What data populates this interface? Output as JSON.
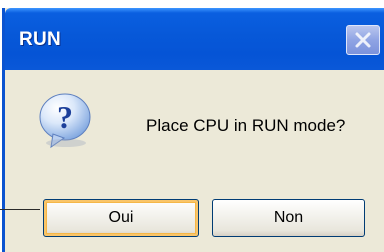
{
  "window": {
    "title": "RUN"
  },
  "titlebar": {
    "close_icon": "close-icon"
  },
  "dialog": {
    "icon": "question-icon",
    "message": "Place CPU in RUN mode?"
  },
  "buttons": {
    "yes_label": "Oui",
    "no_label": "Non"
  },
  "colors": {
    "titlebar": "#0758d8",
    "body": "#ece9d8",
    "focus_ring": "#f5b748"
  }
}
